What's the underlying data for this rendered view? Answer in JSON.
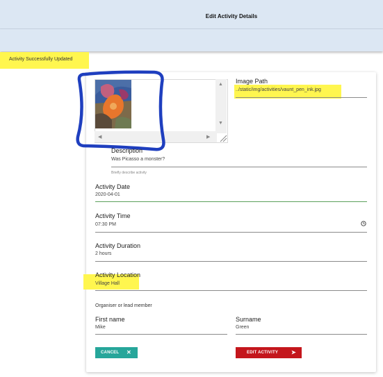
{
  "header": {
    "title": "Edit Activity Details"
  },
  "alert": {
    "message": "Activity Successfully Updated"
  },
  "form": {
    "image_path": {
      "label": "Image Path",
      "value": "../static/img/activities/vaunt_pen_ink.jpg"
    },
    "description": {
      "label": "Description",
      "value": "Was Picasso a monster?",
      "hint": "Briefly describe activity"
    },
    "activity_date": {
      "label": "Activity Date",
      "value": "2020-04-01"
    },
    "activity_time": {
      "label": "Activity Time",
      "value": "07:30 PM"
    },
    "activity_duration": {
      "label": "Activity Duration",
      "value": "2 hours"
    },
    "activity_location": {
      "label": "Activity Location",
      "value": "Village Hall"
    },
    "organiser_heading": "Organiser or lead member",
    "first_name": {
      "label": "First name",
      "value": "Mike"
    },
    "surname": {
      "label": "Surname",
      "value": "Green"
    }
  },
  "buttons": {
    "cancel": "CANCEL",
    "edit": "EDIT ACTIVITY"
  },
  "icons": {
    "cancel": "close-icon",
    "edit": "send-icon",
    "time": "clock-icon"
  },
  "colors": {
    "header_bg": "#dce7f3",
    "highlight": "#fff64f",
    "annotation": "#1f3fbf",
    "cancel": "#26a69a",
    "edit": "#c4161c",
    "active_underline": "#5aa05a"
  }
}
